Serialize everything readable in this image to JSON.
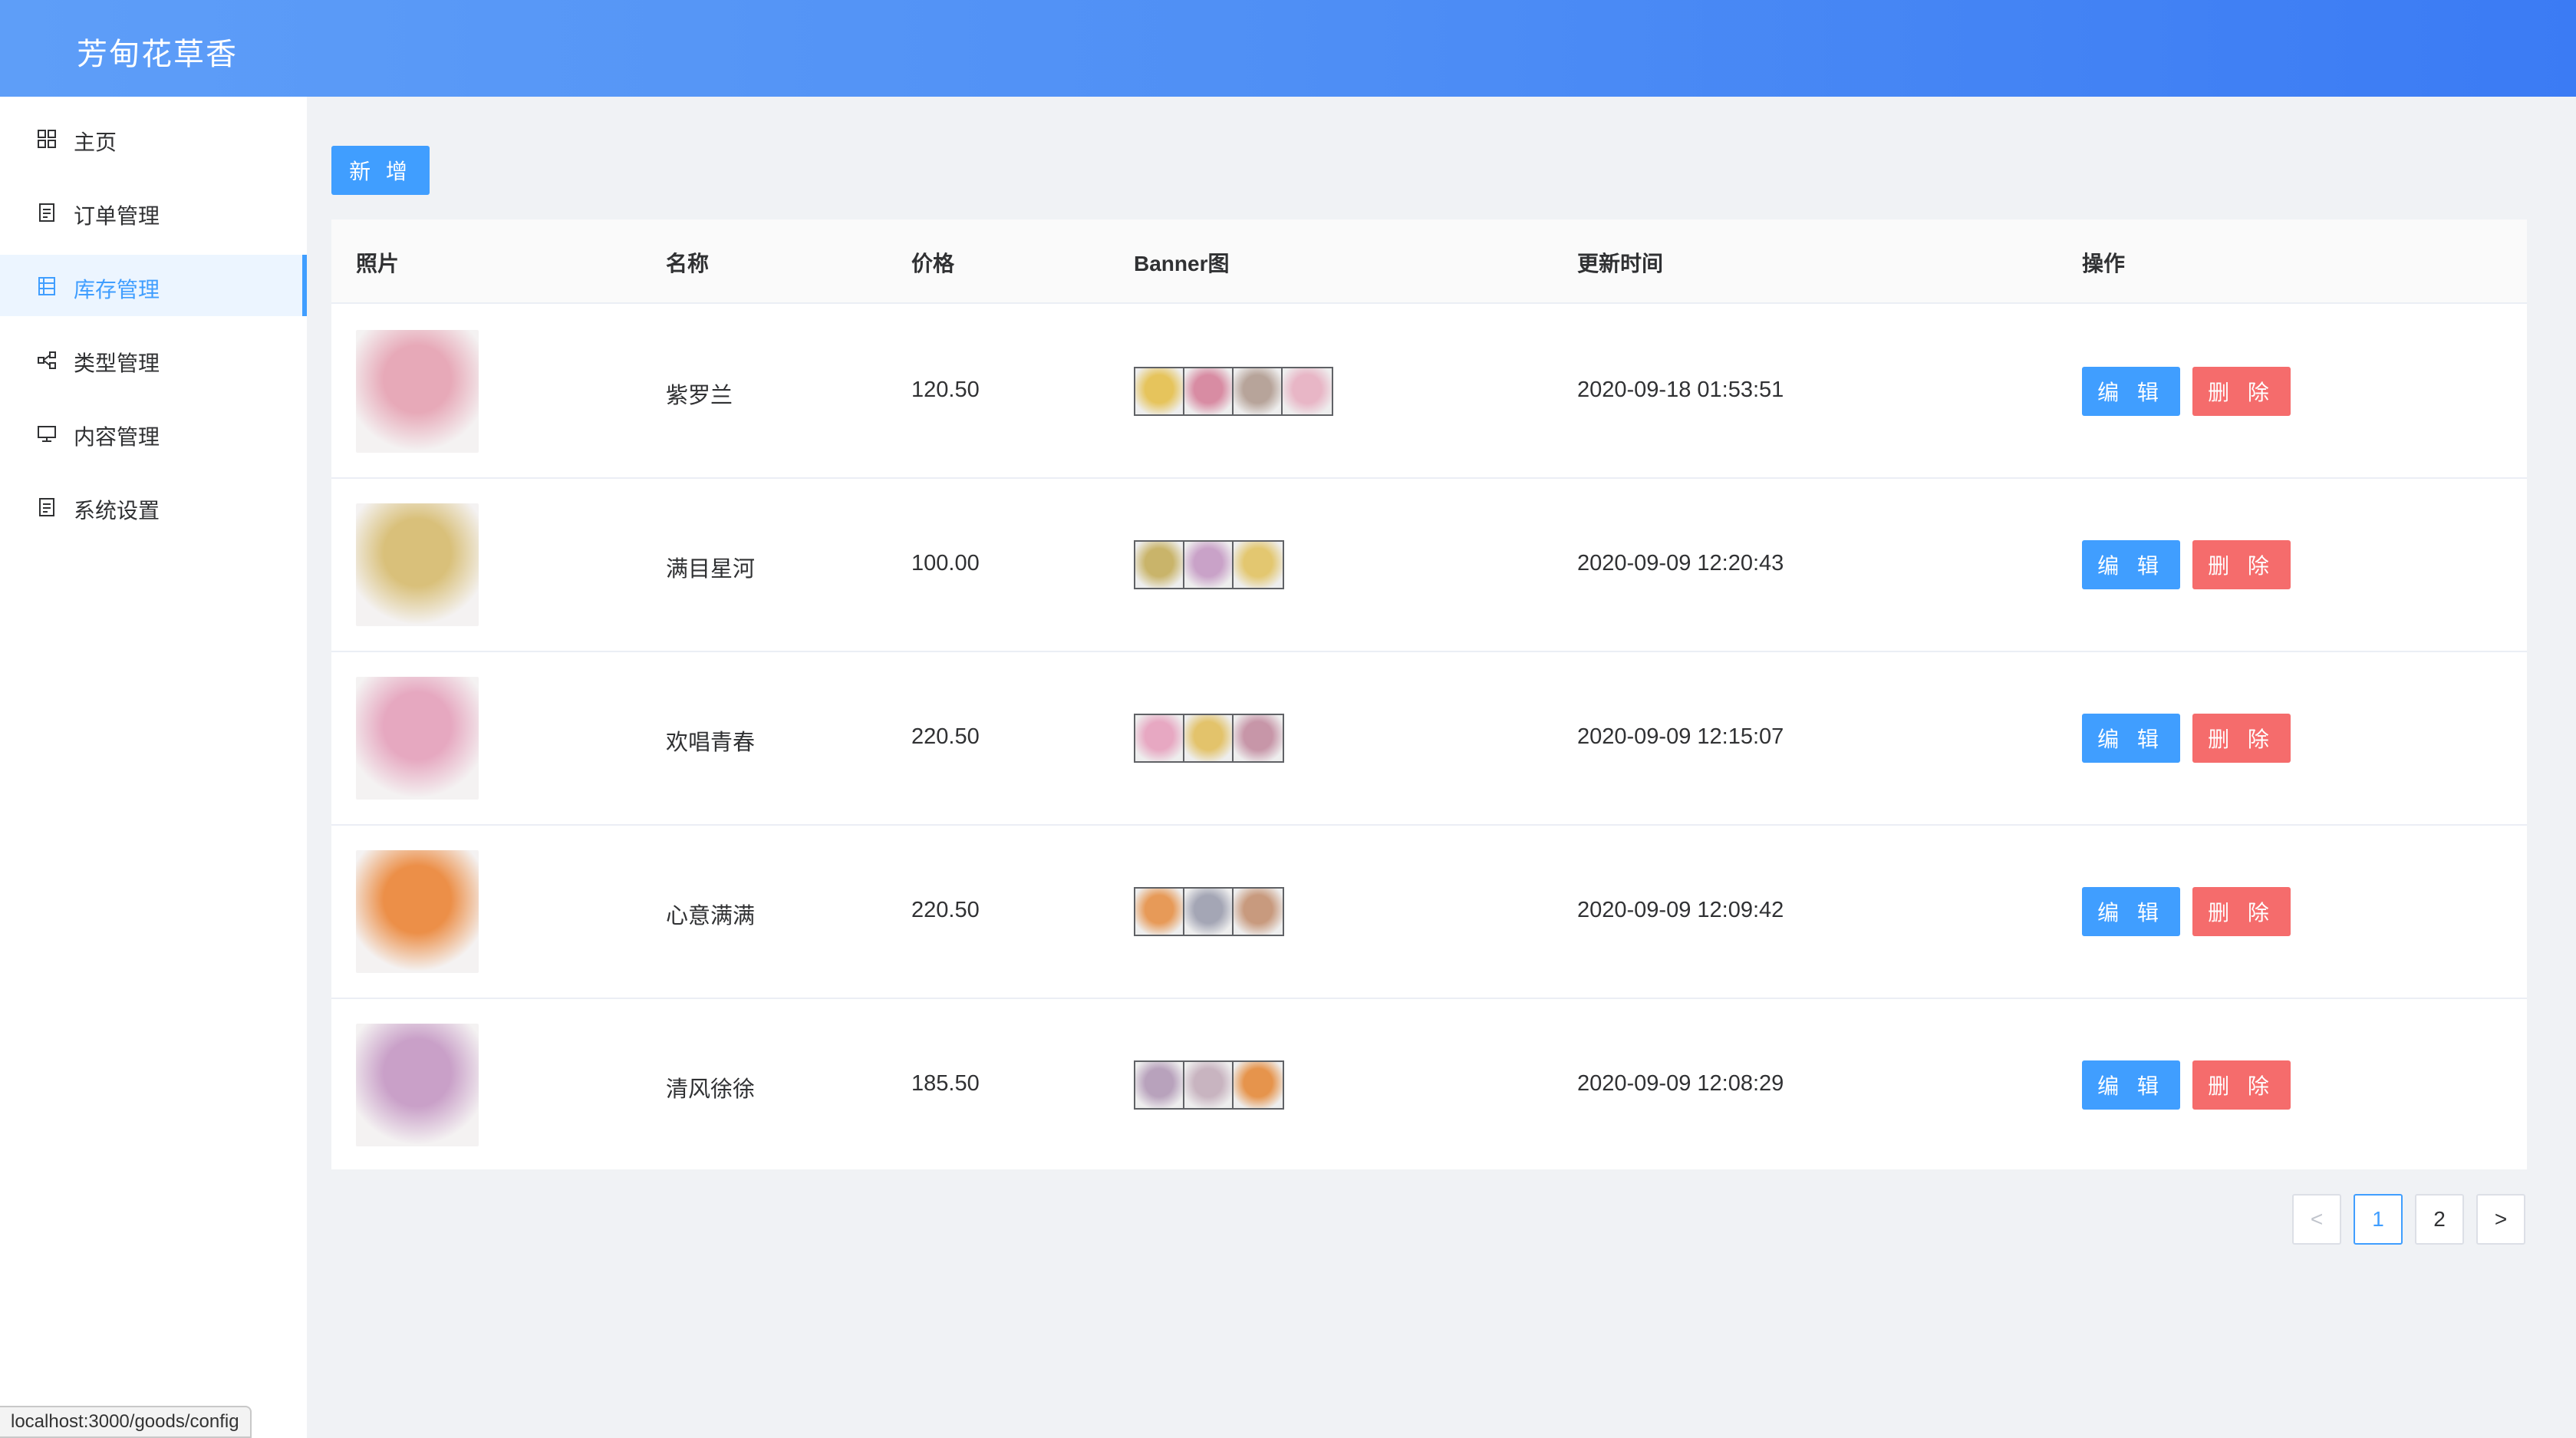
{
  "brand": "芳甸花草香",
  "sidebar": {
    "items": [
      {
        "label": "主页",
        "icon": "grid-icon"
      },
      {
        "label": "订单管理",
        "icon": "document-icon"
      },
      {
        "label": "库存管理",
        "icon": "list-icon",
        "active": true
      },
      {
        "label": "类型管理",
        "icon": "share-icon"
      },
      {
        "label": "内容管理",
        "icon": "monitor-icon"
      },
      {
        "label": "系统设置",
        "icon": "document-icon"
      }
    ]
  },
  "toolbar": {
    "add_label": "新 增"
  },
  "table": {
    "headers": {
      "photo": "照片",
      "name": "名称",
      "price": "价格",
      "banner": "Banner图",
      "updated": "更新时间",
      "actions": "操作"
    },
    "edit_label": "编 辑",
    "delete_label": "删 除",
    "rows": [
      {
        "name": "紫罗兰",
        "price": "120.50",
        "updated": "2020-09-18 01:53:51",
        "photo_color": "#e7a9b8",
        "banner_colors": [
          "#e6c45c",
          "#d88ca3",
          "#b7a49a",
          "#e8b6c6"
        ]
      },
      {
        "name": "满目星河",
        "price": "100.00",
        "updated": "2020-09-09 12:20:43",
        "photo_color": "#d9c07a",
        "banner_colors": [
          "#c9b46a",
          "#c9a2c8",
          "#e3c770"
        ]
      },
      {
        "name": "欢唱青春",
        "price": "220.50",
        "updated": "2020-09-09 12:15:07",
        "photo_color": "#e6a8c0",
        "banner_colors": [
          "#e7a8c2",
          "#e3c36b",
          "#c796a8"
        ]
      },
      {
        "name": "心意满满",
        "price": "220.50",
        "updated": "2020-09-09 12:09:42",
        "photo_color": "#ec8f48",
        "banner_colors": [
          "#e79a58",
          "#a4a6b5",
          "#c89a7e"
        ]
      },
      {
        "name": "清风徐徐",
        "price": "185.50",
        "updated": "2020-09-09 12:08:29",
        "photo_color": "#c9a0c8",
        "banner_colors": [
          "#b8a2bc",
          "#c8b4c0",
          "#e6944c"
        ]
      }
    ]
  },
  "pagination": {
    "prev": "<",
    "pages": [
      "1",
      "2"
    ],
    "current": "1",
    "next": ">"
  },
  "status_url": "localhost:3000/goods/config",
  "colors": {
    "accent": "#409eff",
    "danger": "#f56c6c",
    "header_start": "#5e9ef8",
    "header_end": "#3b7bf4"
  }
}
